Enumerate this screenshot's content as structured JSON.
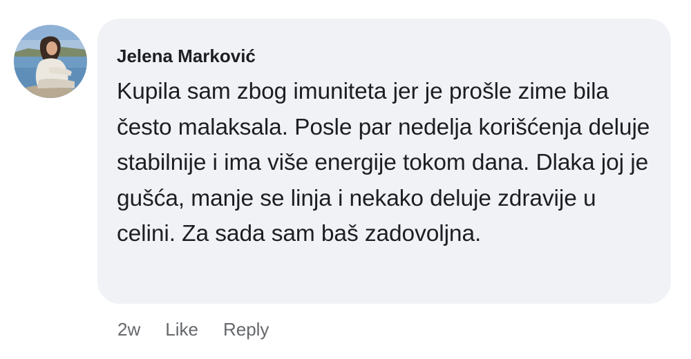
{
  "comment": {
    "author": "Jelena Marković",
    "text": "Kupila sam zbog imuniteta jer je prošle zime bila često malaksala. Posle par nedelja korišćenja deluje stabilnije i ima više energije tokom dana. Dlaka joj je gušća, manje se linja i nekako deluje zdravije u celini. Za sada sam baš zadovoljna.",
    "timestamp": "2w",
    "like_label": "Like",
    "reply_label": "Reply"
  },
  "colors": {
    "bubble_background": "#f0f2f5",
    "text_primary": "#1c1e21",
    "text_secondary": "#65676b"
  }
}
